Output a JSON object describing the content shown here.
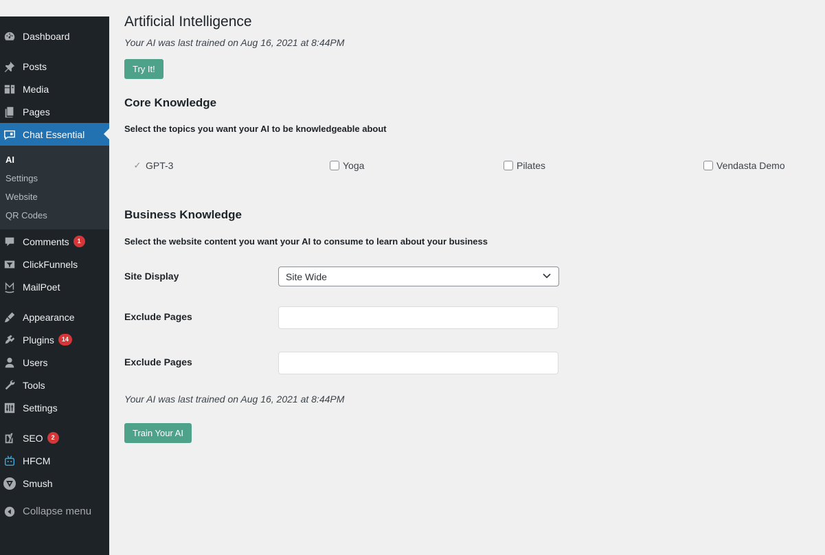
{
  "sidebar": {
    "items": [
      {
        "label": "Dashboard",
        "icon": "dashboard-icon"
      },
      {
        "label": "Posts",
        "icon": "pin-icon"
      },
      {
        "label": "Media",
        "icon": "media-icon"
      },
      {
        "label": "Pages",
        "icon": "pages-icon"
      },
      {
        "label": "Chat Essential",
        "icon": "chat-icon"
      },
      {
        "label": "Comments",
        "icon": "comment-icon",
        "badge": "1"
      },
      {
        "label": "ClickFunnels",
        "icon": "clickfunnels-icon"
      },
      {
        "label": "MailPoet",
        "icon": "mailpoet-icon"
      },
      {
        "label": "Appearance",
        "icon": "brush-icon"
      },
      {
        "label": "Plugins",
        "icon": "plugin-icon",
        "badge": "14"
      },
      {
        "label": "Users",
        "icon": "user-icon"
      },
      {
        "label": "Tools",
        "icon": "wrench-icon"
      },
      {
        "label": "Settings",
        "icon": "settings-icon"
      },
      {
        "label": "SEO",
        "icon": "yoast-icon",
        "badge": "2"
      },
      {
        "label": "HFCM",
        "icon": "robot-icon"
      },
      {
        "label": "Smush",
        "icon": "smush-icon"
      },
      {
        "label": "Collapse menu",
        "icon": "collapse-icon"
      }
    ],
    "submenu": [
      "AI",
      "Settings",
      "Website",
      "QR Codes"
    ]
  },
  "main": {
    "title": "Artificial Intelligence",
    "last_trained": "Your AI was last trained on Aug 16, 2021 at 8:44PM",
    "try_button": "Try It!",
    "core": {
      "heading": "Core Knowledge",
      "description": "Select the topics you want your AI to be knowledgeable about",
      "topics": [
        {
          "label": "GPT-3",
          "checked": true
        },
        {
          "label": "Yoga",
          "checked": false
        },
        {
          "label": "Pilates",
          "checked": false
        },
        {
          "label": "Vendasta Demo",
          "checked": false
        }
      ]
    },
    "business": {
      "heading": "Business Knowledge",
      "description": "Select the website content you want your AI to consume to learn about your business",
      "site_display_label": "Site Display",
      "site_display_value": "Site Wide",
      "exclude_label_1": "Exclude Pages",
      "exclude_label_2": "Exclude Pages"
    },
    "last_trained_bottom": "Your AI was last trained on Aug 16, 2021 at 8:44PM",
    "train_button": "Train Your AI"
  },
  "colors": {
    "sidebar_bg": "#1d2327",
    "active_bg": "#2271b1",
    "button_bg": "#4fa28a",
    "badge_bg": "#d63638"
  }
}
